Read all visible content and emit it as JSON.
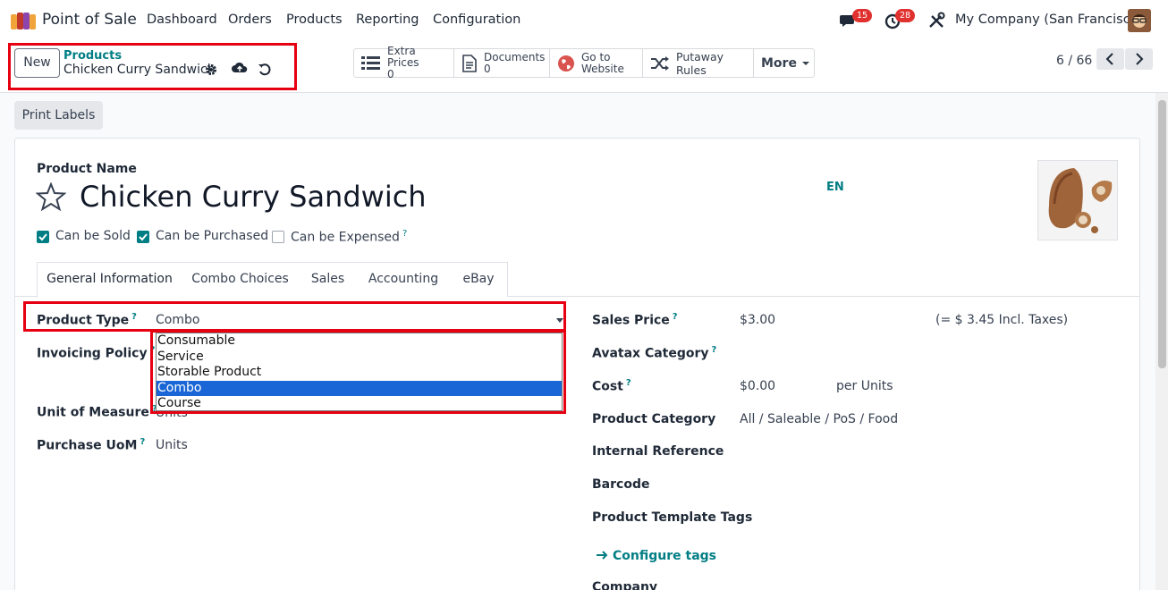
{
  "navbar": {
    "app_name": "Point of Sale",
    "menu": [
      "Dashboard",
      "Orders",
      "Products",
      "Reporting",
      "Configuration"
    ],
    "messages_count": "15",
    "activities_count": "28",
    "company": "My Company (San Francisco)"
  },
  "control_panel": {
    "new_label": "New",
    "breadcrumb_parent": "Products",
    "breadcrumb_current": "Chicken Curry Sandwich",
    "smart_buttons": {
      "extra_prices": {
        "label": "Extra Prices",
        "count": "0"
      },
      "documents": {
        "label": "Documents",
        "count": "0"
      },
      "website": {
        "line1": "Go to",
        "line2": "Website"
      },
      "putaway": {
        "label": "Putaway Rules"
      },
      "more": {
        "label": "More"
      }
    },
    "pager": "6 / 66"
  },
  "actions": {
    "print_labels": "Print Labels"
  },
  "form": {
    "name_label": "Product Name",
    "product_name": "Chicken Curry Sandwich",
    "lang": "EN",
    "checks": {
      "can_be_sold": {
        "label": "Can be Sold",
        "checked": true
      },
      "can_be_purchased": {
        "label": "Can be Purchased",
        "checked": true
      },
      "can_be_expensed": {
        "label": "Can be Expensed",
        "checked": false
      }
    },
    "help_mark": "?",
    "tabs": [
      "General Information",
      "Combo Choices",
      "Sales",
      "Accounting",
      "eBay"
    ],
    "active_tab": "General Information",
    "left": {
      "product_type": {
        "label": "Product Type",
        "value": "Combo"
      },
      "invoicing_policy": {
        "label": "Invoicing Policy"
      },
      "unit_of_measure": {
        "label": "Unit of Measure",
        "value": "Units"
      },
      "purchase_uom": {
        "label": "Purchase UoM",
        "value": "Units"
      }
    },
    "dropdown_options": [
      "Consumable",
      "Service",
      "Storable Product",
      "Combo",
      "Course"
    ],
    "dropdown_selected": "Combo",
    "right": {
      "sales_price": {
        "label": "Sales Price",
        "value": "$3.00",
        "incl": "(= $ 3.45 Incl. Taxes)"
      },
      "avatax_category": {
        "label": "Avatax Category"
      },
      "cost": {
        "label": "Cost",
        "value": "$0.00",
        "unit": "per Units"
      },
      "product_category": {
        "label": "Product Category",
        "value": "All / Saleable / PoS / Food"
      },
      "internal_reference": {
        "label": "Internal Reference"
      },
      "barcode": {
        "label": "Barcode"
      },
      "template_tags": {
        "label": "Product Template Tags"
      },
      "configure_tags": "Configure tags",
      "company": {
        "label": "Company"
      }
    }
  },
  "colors": {
    "accent": "#017e84",
    "highlight": "#e60012",
    "selected_option": "#1a66d6",
    "badge": "#e0312f"
  }
}
